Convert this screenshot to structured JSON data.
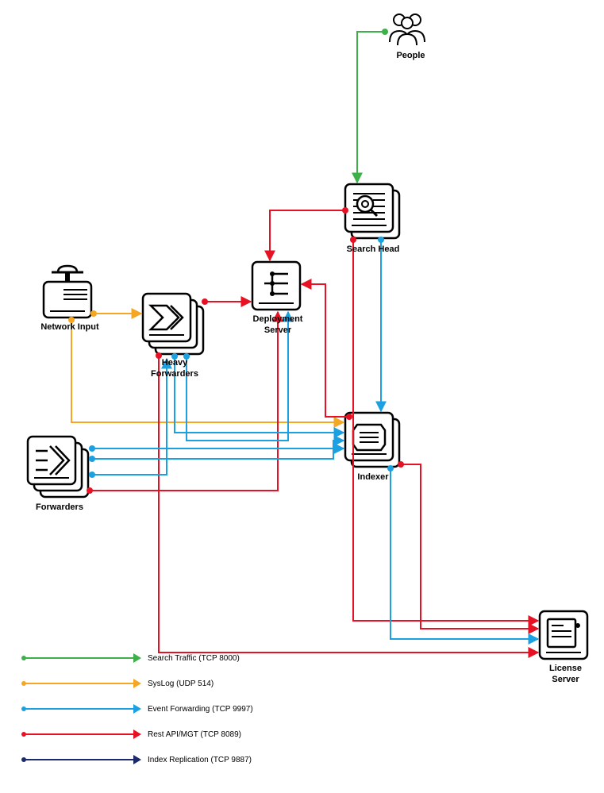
{
  "nodes": {
    "people": "People",
    "search_head": "Search Head",
    "deployment_server": "Deployment Server",
    "network_input": "Network Input",
    "heavy_forwarders": "Heavy Forwarders",
    "forwarders": "Forwarders",
    "indexer": "Indexer",
    "license_server": "License Server"
  },
  "legend": {
    "search_traffic": "Search Traffic (TCP 8000)",
    "syslog": "SysLog (UDP 514)",
    "event_forwarding": "Event Forwarding (TCP 9997)",
    "rest_api": "Rest API/MGT (TCP 8089)",
    "index_replication": "Index Replication (TCP 9887)"
  },
  "colors": {
    "green": "#3eb049",
    "orange": "#f5a623",
    "cyan": "#1ba1e2",
    "red": "#e81123",
    "navy": "#1a2a6c"
  }
}
